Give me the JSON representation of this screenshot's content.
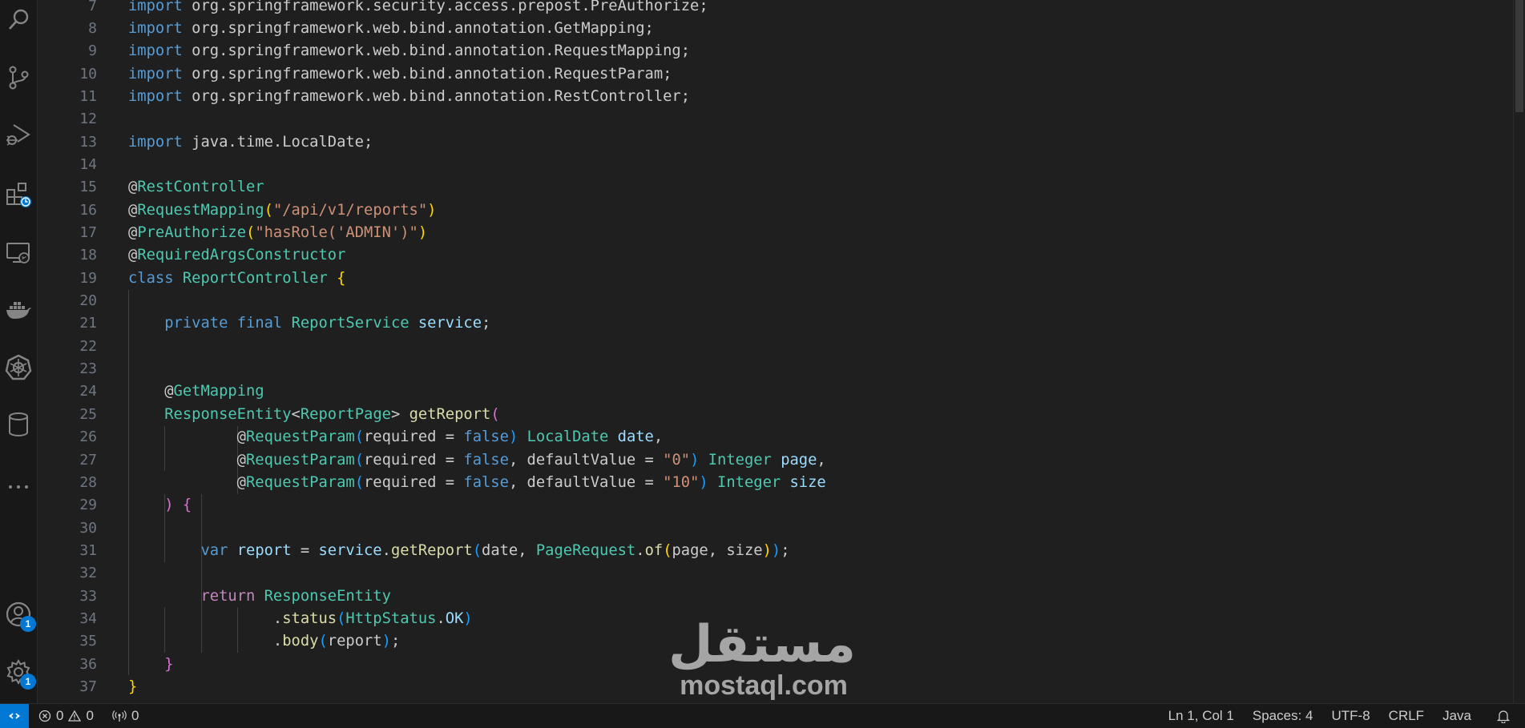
{
  "activity_bar": {
    "items": [
      {
        "name": "search-icon"
      },
      {
        "name": "source-control-icon"
      },
      {
        "name": "run-debug-icon"
      },
      {
        "name": "extensions-icon"
      },
      {
        "name": "remote-explorer-icon"
      },
      {
        "name": "docker-icon"
      },
      {
        "name": "kubernetes-icon"
      },
      {
        "name": "database-icon"
      },
      {
        "name": "more-icon"
      }
    ],
    "accounts_badge": "1",
    "settings_badge": "1"
  },
  "editor": {
    "colors": {
      "keyword": "#569cd6",
      "control": "#c586c0",
      "type": "#4ec9b0",
      "string": "#ce9178",
      "variable": "#9cdcfe",
      "function": "#dcdcaa",
      "plain": "#cccccc",
      "bracket1": "#ffd700",
      "bracket2": "#da70d6",
      "bracket3": "#179fff",
      "number_line": "#6e7681"
    },
    "lines": [
      {
        "n": "7",
        "t": [
          [
            "kw",
            "import"
          ],
          [
            "p",
            " org.springframework.security.access.prepost.PreAuthorize;"
          ]
        ]
      },
      {
        "n": "8",
        "t": [
          [
            "kw",
            "import"
          ],
          [
            "p",
            " org.springframework.web.bind.annotation.GetMapping;"
          ]
        ]
      },
      {
        "n": "9",
        "t": [
          [
            "kw",
            "import"
          ],
          [
            "p",
            " org.springframework.web.bind.annotation.RequestMapping;"
          ]
        ]
      },
      {
        "n": "10",
        "t": [
          [
            "kw",
            "import"
          ],
          [
            "p",
            " org.springframework.web.bind.annotation.RequestParam;"
          ]
        ]
      },
      {
        "n": "11",
        "t": [
          [
            "kw",
            "import"
          ],
          [
            "p",
            " org.springframework.web.bind.annotation.RestController;"
          ]
        ]
      },
      {
        "n": "12",
        "t": []
      },
      {
        "n": "13",
        "t": [
          [
            "kw",
            "import"
          ],
          [
            "p",
            " java.time.LocalDate;"
          ]
        ]
      },
      {
        "n": "14",
        "t": []
      },
      {
        "n": "15",
        "t": [
          [
            "p",
            "@"
          ],
          [
            "ty",
            "RestController"
          ]
        ]
      },
      {
        "n": "16",
        "t": [
          [
            "p",
            "@"
          ],
          [
            "ty",
            "RequestMapping"
          ],
          [
            "b1",
            "("
          ],
          [
            "st",
            "\"/api/v1/reports\""
          ],
          [
            "b1",
            ")"
          ]
        ]
      },
      {
        "n": "17",
        "t": [
          [
            "p",
            "@"
          ],
          [
            "ty",
            "PreAuthorize"
          ],
          [
            "b1",
            "("
          ],
          [
            "st",
            "\"hasRole('ADMIN')\""
          ],
          [
            "b1",
            ")"
          ]
        ]
      },
      {
        "n": "18",
        "t": [
          [
            "p",
            "@"
          ],
          [
            "ty",
            "RequiredArgsConstructor"
          ]
        ]
      },
      {
        "n": "19",
        "t": [
          [
            "kw",
            "class"
          ],
          [
            "p",
            " "
          ],
          [
            "ty",
            "ReportController"
          ],
          [
            "p",
            " "
          ],
          [
            "b1",
            "{"
          ]
        ]
      },
      {
        "n": "20",
        "t": []
      },
      {
        "n": "21",
        "t": [
          [
            "p",
            "    "
          ],
          [
            "kw",
            "private"
          ],
          [
            "p",
            " "
          ],
          [
            "kw",
            "final"
          ],
          [
            "p",
            " "
          ],
          [
            "ty",
            "ReportService"
          ],
          [
            "p",
            " "
          ],
          [
            "va",
            "service"
          ],
          [
            "p",
            ";"
          ]
        ]
      },
      {
        "n": "22",
        "t": []
      },
      {
        "n": "23",
        "t": []
      },
      {
        "n": "24",
        "t": [
          [
            "p",
            "    @"
          ],
          [
            "ty",
            "GetMapping"
          ]
        ]
      },
      {
        "n": "25",
        "t": [
          [
            "p",
            "    "
          ],
          [
            "ty",
            "ResponseEntity"
          ],
          [
            "p",
            "<"
          ],
          [
            "ty",
            "ReportPage"
          ],
          [
            "p",
            "> "
          ],
          [
            "fn",
            "getReport"
          ],
          [
            "b2",
            "("
          ]
        ]
      },
      {
        "n": "26",
        "t": [
          [
            "p",
            "            @"
          ],
          [
            "ty",
            "RequestParam"
          ],
          [
            "b3",
            "("
          ],
          [
            "p",
            "required = "
          ],
          [
            "kw",
            "false"
          ],
          [
            "b3",
            ")"
          ],
          [
            "p",
            " "
          ],
          [
            "ty",
            "LocalDate"
          ],
          [
            "p",
            " "
          ],
          [
            "va",
            "date"
          ],
          [
            "p",
            ","
          ]
        ]
      },
      {
        "n": "27",
        "t": [
          [
            "p",
            "            @"
          ],
          [
            "ty",
            "RequestParam"
          ],
          [
            "b3",
            "("
          ],
          [
            "p",
            "required = "
          ],
          [
            "kw",
            "false"
          ],
          [
            "p",
            ", defaultValue = "
          ],
          [
            "st",
            "\"0\""
          ],
          [
            "b3",
            ")"
          ],
          [
            "p",
            " "
          ],
          [
            "ty",
            "Integer"
          ],
          [
            "p",
            " "
          ],
          [
            "va",
            "page"
          ],
          [
            "p",
            ","
          ]
        ]
      },
      {
        "n": "28",
        "t": [
          [
            "p",
            "            @"
          ],
          [
            "ty",
            "RequestParam"
          ],
          [
            "b3",
            "("
          ],
          [
            "p",
            "required = "
          ],
          [
            "kw",
            "false"
          ],
          [
            "p",
            ", defaultValue = "
          ],
          [
            "st",
            "\"10\""
          ],
          [
            "b3",
            ")"
          ],
          [
            "p",
            " "
          ],
          [
            "ty",
            "Integer"
          ],
          [
            "p",
            " "
          ],
          [
            "va",
            "size"
          ]
        ]
      },
      {
        "n": "29",
        "t": [
          [
            "p",
            "    "
          ],
          [
            "b2",
            ")"
          ],
          [
            "p",
            " "
          ],
          [
            "b2",
            "{"
          ]
        ]
      },
      {
        "n": "30",
        "t": []
      },
      {
        "n": "31",
        "t": [
          [
            "p",
            "        "
          ],
          [
            "kw",
            "var"
          ],
          [
            "p",
            " "
          ],
          [
            "va",
            "report"
          ],
          [
            "p",
            " = "
          ],
          [
            "va",
            "service"
          ],
          [
            "p",
            "."
          ],
          [
            "fn",
            "getReport"
          ],
          [
            "b3",
            "("
          ],
          [
            "p",
            "date, "
          ],
          [
            "ty",
            "PageRequest"
          ],
          [
            "p",
            "."
          ],
          [
            "fn",
            "of"
          ],
          [
            "b1",
            "("
          ],
          [
            "p",
            "page, size"
          ],
          [
            "b1",
            ")"
          ],
          [
            "b3",
            ")"
          ],
          [
            "p",
            ";"
          ]
        ]
      },
      {
        "n": "32",
        "t": []
      },
      {
        "n": "33",
        "t": [
          [
            "p",
            "        "
          ],
          [
            "ctl",
            "return"
          ],
          [
            "p",
            " "
          ],
          [
            "ty",
            "ResponseEntity"
          ]
        ]
      },
      {
        "n": "34",
        "t": [
          [
            "p",
            "                ."
          ],
          [
            "fn",
            "status"
          ],
          [
            "b3",
            "("
          ],
          [
            "ty",
            "HttpStatus"
          ],
          [
            "p",
            "."
          ],
          [
            "va",
            "OK"
          ],
          [
            "b3",
            ")"
          ]
        ]
      },
      {
        "n": "35",
        "t": [
          [
            "p",
            "                ."
          ],
          [
            "fn",
            "body"
          ],
          [
            "b3",
            "("
          ],
          [
            "p",
            "report"
          ],
          [
            "b3",
            ")"
          ],
          [
            "p",
            ";"
          ]
        ]
      },
      {
        "n": "36",
        "t": [
          [
            "p",
            "    "
          ],
          [
            "b2",
            "}"
          ]
        ]
      },
      {
        "n": "37",
        "t": [
          [
            "b1",
            "}"
          ]
        ]
      }
    ]
  },
  "watermark": {
    "arabic": "مستقل",
    "latin": "mostaql.com"
  },
  "status_bar": {
    "errors": "0",
    "warnings": "0",
    "ports": "0",
    "position": "Ln 1, Col 1",
    "spaces": "Spaces: 4",
    "encoding": "UTF-8",
    "eol": "CRLF",
    "language": "Java"
  }
}
